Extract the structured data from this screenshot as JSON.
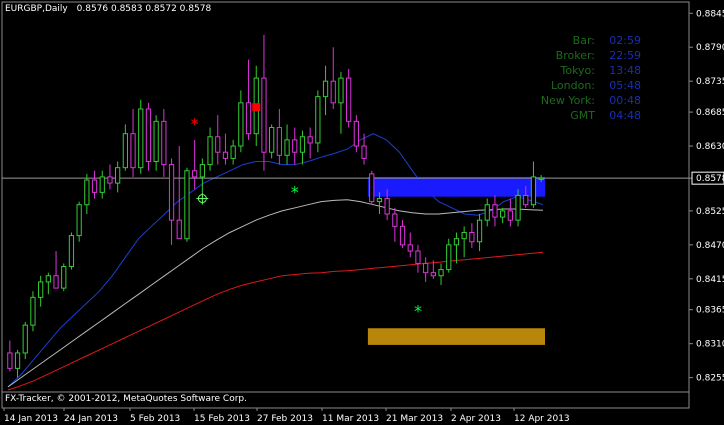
{
  "header": {
    "symbol_timeframe": "EURGBP,Daily",
    "ohlc": "0.8576 0.8583 0.8572 0.8578"
  },
  "footer": {
    "copyright": "FX-Tracker, © 2001-2012, MetaQuotes Software Corp."
  },
  "session_info": [
    {
      "label": "Bar:",
      "value": "02:59"
    },
    {
      "label": "Broker:",
      "value": "22:59"
    },
    {
      "label": "Tokyo:",
      "value": "13:48"
    },
    {
      "label": "London:",
      "value": "05:48"
    },
    {
      "label": "New York:",
      "value": "00:48"
    },
    {
      "label": "GMT",
      "value": "04:48"
    }
  ],
  "colors": {
    "background": "#000000",
    "bull_candle": "#33cc33",
    "bear_candle": "#dd33dd",
    "ma_fast": "#1a3fd6",
    "ma_mid": "#bbbbbb",
    "ma_slow": "#dd1a1a",
    "zone_upper": "#1a1aff",
    "zone_lower": "#b8860b",
    "price_line": "#999999",
    "signal_sell": "#ff0000",
    "signal_buy": "#00ff44"
  },
  "chart_data": {
    "type": "candlestick",
    "ylim": [
      0.8235,
      0.886
    ],
    "y_ticks": [
      "0.8845",
      "0.8790",
      "0.8735",
      "0.8685",
      "0.8630",
      "0.8578",
      "0.8525",
      "0.8470",
      "0.8415",
      "0.8365",
      "0.8310",
      "0.8255"
    ],
    "x_labels": [
      "14 Jan 2013",
      "24 Jan 2013",
      "5 Feb 2013",
      "15 Feb 2013",
      "27 Feb 2013",
      "11 Mar 2013",
      "21 Mar 2013",
      "2 Apr 2013",
      "12 Apr 2013"
    ],
    "current_price": "0.8578",
    "candles": [
      [
        0.8295,
        0.8315,
        0.8265,
        0.827
      ],
      [
        0.827,
        0.83,
        0.8255,
        0.8295
      ],
      [
        0.8295,
        0.8345,
        0.8285,
        0.834
      ],
      [
        0.834,
        0.8395,
        0.833,
        0.8385
      ],
      [
        0.8385,
        0.842,
        0.837,
        0.841
      ],
      [
        0.841,
        0.8425,
        0.839,
        0.842
      ],
      [
        0.842,
        0.846,
        0.84,
        0.84
      ],
      [
        0.84,
        0.844,
        0.8395,
        0.8435
      ],
      [
        0.8435,
        0.849,
        0.843,
        0.8485
      ],
      [
        0.8485,
        0.854,
        0.8475,
        0.8535
      ],
      [
        0.8535,
        0.8585,
        0.852,
        0.8575
      ],
      [
        0.8575,
        0.859,
        0.8545,
        0.8555
      ],
      [
        0.8555,
        0.859,
        0.8545,
        0.858
      ],
      [
        0.858,
        0.86,
        0.856,
        0.857
      ],
      [
        0.857,
        0.8605,
        0.8555,
        0.8595
      ],
      [
        0.8595,
        0.8665,
        0.859,
        0.865
      ],
      [
        0.865,
        0.869,
        0.858,
        0.8595
      ],
      [
        0.8595,
        0.8705,
        0.8585,
        0.869
      ],
      [
        0.869,
        0.87,
        0.859,
        0.8605
      ],
      [
        0.8605,
        0.868,
        0.859,
        0.867
      ],
      [
        0.867,
        0.869,
        0.858,
        0.86
      ],
      [
        0.86,
        0.861,
        0.847,
        0.851
      ],
      [
        0.851,
        0.863,
        0.849,
        0.848
      ],
      [
        0.848,
        0.8595,
        0.8475,
        0.859
      ],
      [
        0.859,
        0.864,
        0.856,
        0.858
      ],
      [
        0.858,
        0.861,
        0.8555,
        0.86
      ],
      [
        0.86,
        0.866,
        0.859,
        0.8645
      ],
      [
        0.8645,
        0.868,
        0.86,
        0.862
      ],
      [
        0.862,
        0.865,
        0.86,
        0.861
      ],
      [
        0.861,
        0.864,
        0.86,
        0.863
      ],
      [
        0.863,
        0.872,
        0.862,
        0.87
      ],
      [
        0.87,
        0.877,
        0.864,
        0.865
      ],
      [
        0.865,
        0.876,
        0.863,
        0.874
      ],
      [
        0.874,
        0.881,
        0.859,
        0.862
      ],
      [
        0.862,
        0.8665,
        0.861,
        0.866
      ],
      [
        0.866,
        0.869,
        0.86,
        0.8615
      ],
      [
        0.8615,
        0.8665,
        0.86,
        0.864
      ],
      [
        0.864,
        0.866,
        0.86,
        0.862
      ],
      [
        0.862,
        0.8655,
        0.86,
        0.8645
      ],
      [
        0.8645,
        0.866,
        0.861,
        0.8635
      ],
      [
        0.8635,
        0.872,
        0.862,
        0.871
      ],
      [
        0.871,
        0.876,
        0.868,
        0.8735
      ],
      [
        0.8735,
        0.879,
        0.869,
        0.87
      ],
      [
        0.87,
        0.875,
        0.865,
        0.874
      ],
      [
        0.874,
        0.8755,
        0.866,
        0.867
      ],
      [
        0.867,
        0.868,
        0.862,
        0.863
      ],
      [
        0.863,
        0.865,
        0.86,
        0.861
      ],
      [
        0.8585,
        0.859,
        0.8535,
        0.854
      ],
      [
        0.854,
        0.8555,
        0.852,
        0.8545
      ],
      [
        0.8545,
        0.856,
        0.851,
        0.852
      ],
      [
        0.852,
        0.853,
        0.8475,
        0.85
      ],
      [
        0.85,
        0.851,
        0.8465,
        0.847
      ],
      [
        0.847,
        0.849,
        0.845,
        0.846
      ],
      [
        0.846,
        0.847,
        0.8425,
        0.844
      ],
      [
        0.844,
        0.845,
        0.841,
        0.8425
      ],
      [
        0.8425,
        0.8445,
        0.8415,
        0.842
      ],
      [
        0.842,
        0.844,
        0.8405,
        0.843
      ],
      [
        0.843,
        0.848,
        0.8425,
        0.847
      ],
      [
        0.847,
        0.849,
        0.844,
        0.848
      ],
      [
        0.848,
        0.85,
        0.845,
        0.849
      ],
      [
        0.849,
        0.8505,
        0.8465,
        0.8475
      ],
      [
        0.8475,
        0.852,
        0.846,
        0.851
      ],
      [
        0.851,
        0.8545,
        0.85,
        0.8535
      ],
      [
        0.8535,
        0.855,
        0.85,
        0.8515
      ],
      [
        0.8515,
        0.853,
        0.8505,
        0.8525
      ],
      [
        0.8525,
        0.8545,
        0.85,
        0.851
      ],
      [
        0.851,
        0.856,
        0.85,
        0.855
      ],
      [
        0.855,
        0.8565,
        0.853,
        0.8535
      ],
      [
        0.8535,
        0.8605,
        0.853,
        0.858
      ],
      [
        0.8576,
        0.8583,
        0.8572,
        0.8578
      ]
    ],
    "ma_fast": [
      0.824,
      0.826,
      0.8285,
      0.831,
      0.8335,
      0.8355,
      0.8375,
      0.8395,
      0.842,
      0.845,
      0.848,
      0.85,
      0.852,
      0.854,
      0.8555,
      0.857,
      0.858,
      0.859,
      0.86,
      0.8605,
      0.8605,
      0.86,
      0.86,
      0.8605,
      0.8612,
      0.8618,
      0.8625,
      0.864,
      0.865,
      0.864,
      0.862,
      0.859,
      0.856,
      0.854,
      0.853,
      0.852,
      0.8518,
      0.8525,
      0.854,
      0.8548,
      0.8542,
      0.8535
    ],
    "ma_mid": [
      0.824,
      0.8255,
      0.827,
      0.8285,
      0.83,
      0.8315,
      0.833,
      0.8345,
      0.836,
      0.8375,
      0.839,
      0.8405,
      0.842,
      0.8435,
      0.845,
      0.8465,
      0.8478,
      0.849,
      0.85,
      0.851,
      0.8518,
      0.8525,
      0.853,
      0.8535,
      0.854,
      0.8542,
      0.8543,
      0.854,
      0.8535,
      0.853,
      0.8525,
      0.8522,
      0.852,
      0.852,
      0.8522,
      0.8524,
      0.8526,
      0.8527,
      0.8528,
      0.8528,
      0.8527,
      0.8526
    ],
    "ma_slow": [
      0.8235,
      0.8242,
      0.825,
      0.826,
      0.827,
      0.828,
      0.829,
      0.83,
      0.831,
      0.832,
      0.833,
      0.834,
      0.835,
      0.836,
      0.837,
      0.838,
      0.839,
      0.8398,
      0.8405,
      0.841,
      0.8415,
      0.842,
      0.8422,
      0.8424,
      0.8425,
      0.8427,
      0.8428,
      0.843,
      0.8432,
      0.8434,
      0.8436,
      0.8438,
      0.844,
      0.8442,
      0.8444,
      0.8446,
      0.8448,
      0.845,
      0.8452,
      0.8454,
      0.8456,
      0.8458
    ],
    "zone_upper": {
      "top": 0.858,
      "bottom": 0.8548,
      "from_bar": 47,
      "to_bar": 69
    },
    "zone_lower": {
      "top": 0.8335,
      "bottom": 0.8308,
      "from_bar": 47,
      "to_bar": 69
    },
    "sell_signals": [
      {
        "bar": 24,
        "price": 0.8665
      }
    ],
    "buy_signals": [
      {
        "bar": 37,
        "price": 0.8555
      },
      {
        "bar": 53,
        "price": 0.8362
      }
    ],
    "square_markers": [
      {
        "bar": 32,
        "price": 0.8693
      }
    ],
    "crosshair_markers": [
      {
        "bar": 25,
        "price": 0.8545
      }
    ]
  }
}
